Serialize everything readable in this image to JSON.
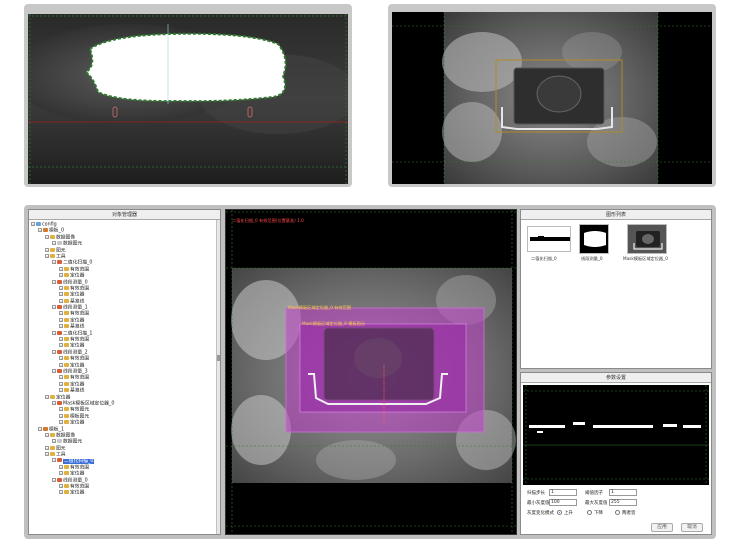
{
  "tree": {
    "title": "对象管理器",
    "nodes": [
      {
        "label": "config",
        "depth": 0,
        "icon": "config-icon",
        "color": "#6aa0d8"
      },
      {
        "label": "模板_0",
        "depth": 1,
        "icon": "template-icon",
        "color": "#d07b2b"
      },
      {
        "label": "数据图像",
        "depth": 2,
        "icon": "image-folder-icon",
        "color": "#e0b040"
      },
      {
        "label": "数据图元",
        "depth": 3,
        "icon": "element-icon",
        "color": "#c8c8c8"
      },
      {
        "label": "图元",
        "depth": 2,
        "icon": "folder-icon",
        "color": "#e0b040"
      },
      {
        "label": "工具",
        "depth": 2,
        "icon": "tools-icon",
        "color": "#e0b040"
      },
      {
        "label": "二值化扫描_0",
        "depth": 3,
        "icon": "tool-icon",
        "color": "#d85b3a"
      },
      {
        "label": "有效范围",
        "depth": 4,
        "icon": "range-icon",
        "color": "#e0b040"
      },
      {
        "label": "定位器",
        "depth": 4,
        "icon": "locator-icon",
        "color": "#e0b040"
      },
      {
        "label": "线段测量_0",
        "depth": 3,
        "icon": "tool-icon",
        "color": "#d85b3a"
      },
      {
        "label": "有效范围",
        "depth": 4,
        "icon": "range-icon",
        "color": "#e0b040"
      },
      {
        "label": "定位器",
        "depth": 4,
        "icon": "locator-icon",
        "color": "#e0b040"
      },
      {
        "label": "基准线",
        "depth": 4,
        "icon": "baseline-icon",
        "color": "#e0b040"
      },
      {
        "label": "线段测量_1",
        "depth": 3,
        "icon": "tool-icon",
        "color": "#d85b3a"
      },
      {
        "label": "有效范围",
        "depth": 4,
        "icon": "range-icon",
        "color": "#e0b040"
      },
      {
        "label": "定位器",
        "depth": 4,
        "icon": "locator-icon",
        "color": "#e0b040"
      },
      {
        "label": "基准线",
        "depth": 4,
        "icon": "baseline-icon",
        "color": "#e0b040"
      },
      {
        "label": "二值化扫描_1",
        "depth": 3,
        "icon": "tool-icon",
        "color": "#d85b3a"
      },
      {
        "label": "有效范围",
        "depth": 4,
        "icon": "range-icon",
        "color": "#e0b040"
      },
      {
        "label": "定位器",
        "depth": 4,
        "icon": "locator-icon",
        "color": "#e0b040"
      },
      {
        "label": "线段测量_2",
        "depth": 3,
        "icon": "tool-icon",
        "color": "#d85b3a"
      },
      {
        "label": "有效范围",
        "depth": 4,
        "icon": "range-icon",
        "color": "#e0b040"
      },
      {
        "label": "定位器",
        "depth": 4,
        "icon": "locator-icon",
        "color": "#e0b040"
      },
      {
        "label": "线段测量_3",
        "depth": 3,
        "icon": "tool-icon",
        "color": "#d85b3a"
      },
      {
        "label": "有效范围",
        "depth": 4,
        "icon": "range-icon",
        "color": "#e0b040"
      },
      {
        "label": "定位器",
        "depth": 4,
        "icon": "locator-icon",
        "color": "#e0b040"
      },
      {
        "label": "基准线",
        "depth": 4,
        "icon": "baseline-icon",
        "color": "#e0b040"
      },
      {
        "label": "定位器",
        "depth": 2,
        "icon": "locator-icon",
        "color": "#e0b040"
      },
      {
        "label": "Mask模板区域定位器_0",
        "depth": 3,
        "icon": "mask-tool-icon",
        "color": "#d85b3a"
      },
      {
        "label": "有效图元",
        "depth": 4,
        "icon": "element-icon",
        "color": "#e0b040"
      },
      {
        "label": "模板图元",
        "depth": 4,
        "icon": "element-icon",
        "color": "#e0b040"
      },
      {
        "label": "定位器",
        "depth": 4,
        "icon": "locator-icon",
        "color": "#e0b040"
      },
      {
        "label": "模板_1",
        "depth": 1,
        "icon": "template-icon",
        "color": "#d07b2b"
      },
      {
        "label": "数据图像",
        "depth": 2,
        "icon": "image-folder-icon",
        "color": "#e0b040"
      },
      {
        "label": "数据图元",
        "depth": 3,
        "icon": "element-icon",
        "color": "#c8c8c8"
      },
      {
        "label": "图元",
        "depth": 2,
        "icon": "folder-icon",
        "color": "#e0b040"
      },
      {
        "label": "工具",
        "depth": 2,
        "icon": "tools-icon",
        "color": "#e0b040"
      },
      {
        "label": "二值化扫描_0",
        "depth": 3,
        "icon": "tool-icon",
        "color": "#d85b3a",
        "selected": true
      },
      {
        "label": "有效范围",
        "depth": 4,
        "icon": "range-icon",
        "color": "#e0b040"
      },
      {
        "label": "定位器",
        "depth": 4,
        "icon": "locator-icon",
        "color": "#e0b040"
      },
      {
        "label": "线段测量_0",
        "depth": 3,
        "icon": "tool-icon",
        "color": "#d85b3a"
      },
      {
        "label": "有效范围",
        "depth": 4,
        "icon": "range-icon",
        "color": "#e0b040"
      },
      {
        "label": "定位器",
        "depth": 4,
        "icon": "locator-icon",
        "color": "#e0b040"
      }
    ]
  },
  "canvas": {
    "overlay_red": "二值化扫描_0 有效范围(位置基准) 1.0",
    "overlay_outer": "Mask模板区域定位器_0 有效范围",
    "overlay_inner": "Mask模板区域定位器_0 模板图元"
  },
  "gallery": {
    "title": "图形列表",
    "items": [
      {
        "label": "二值化扫描_0"
      },
      {
        "label": "线段测量_0"
      },
      {
        "label": "Mask模板区域定位器_0"
      }
    ]
  },
  "params": {
    "title": "参数设置",
    "scan_step_label": "扫描步长",
    "scan_step_value": "1",
    "binarize_label": "阈值因子",
    "binarize_value": "1",
    "min_threshold_label": "最小灰度值",
    "min_threshold_value": "100",
    "max_threshold_label": "最大灰度值",
    "max_threshold_value": "255",
    "direction_label": "灰度变化模式",
    "direction_opt1": "上升",
    "direction_opt2": "下降",
    "direction_opt3": "两者皆",
    "apply_label": "应用",
    "cancel_label": "取消"
  },
  "colors": {
    "accent_selected": "#3a6fd8",
    "mask_magenta": "#c040c8",
    "grid_green": "#2f7a2f",
    "overlay_red": "#ff4848"
  }
}
